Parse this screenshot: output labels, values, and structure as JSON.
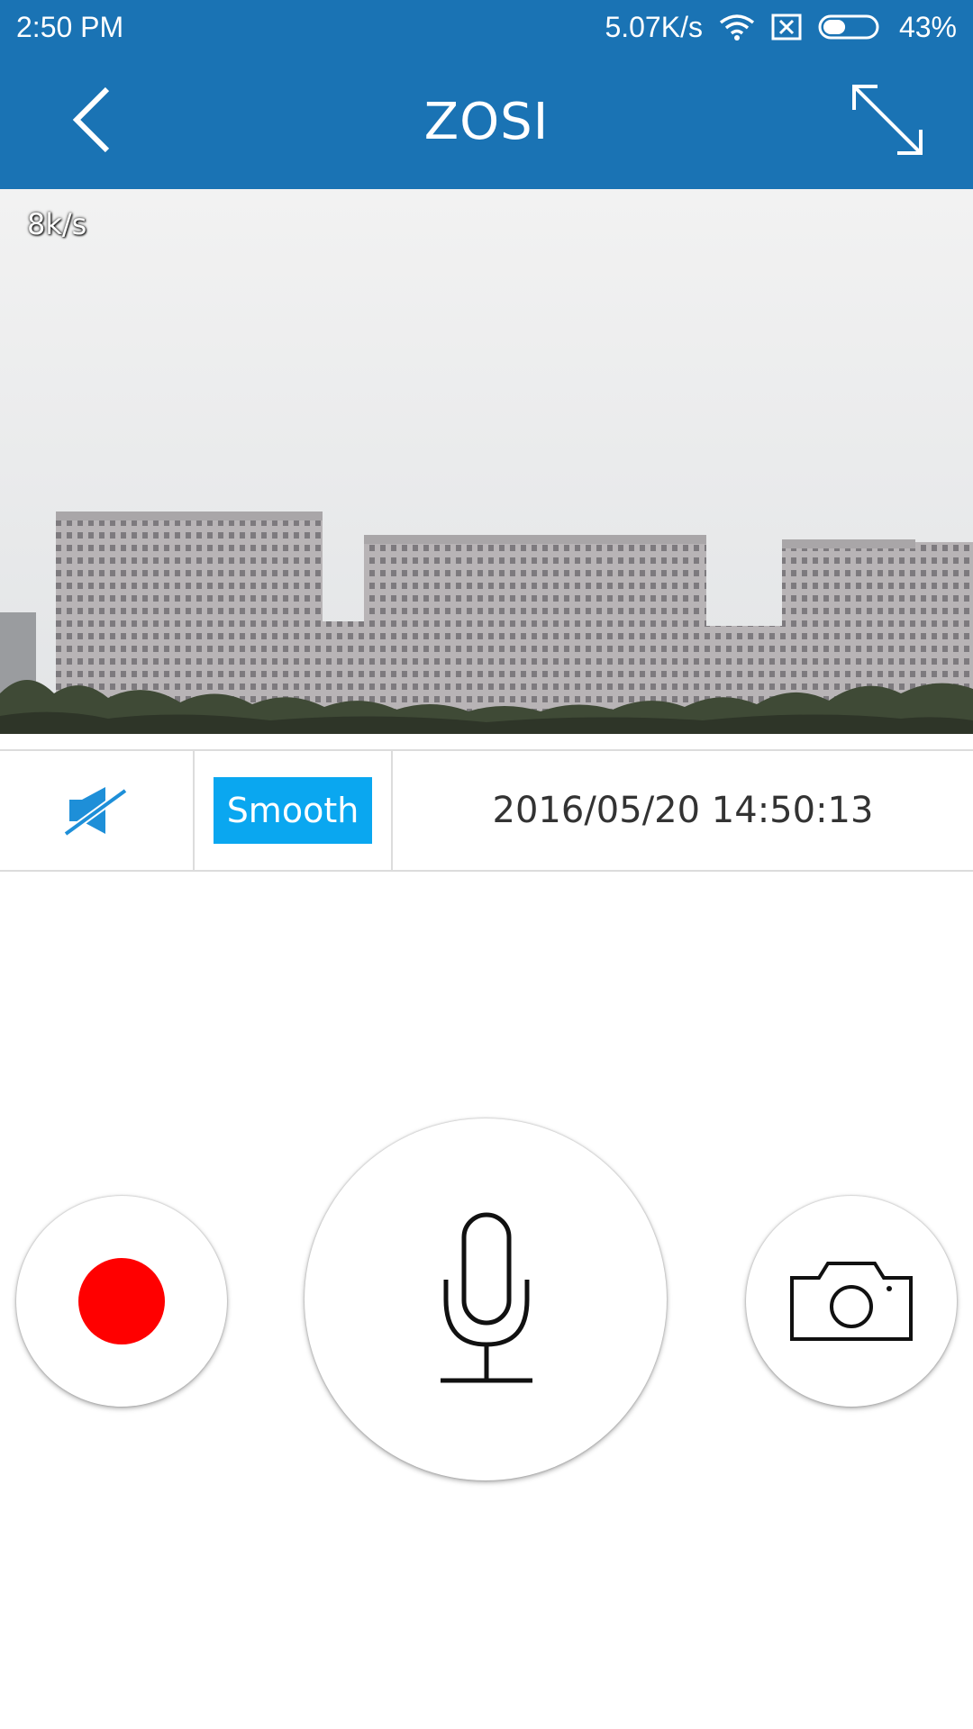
{
  "status_bar": {
    "time": "2:50 PM",
    "network_speed": "5.07K/s",
    "battery": "43%",
    "battery_level": 0.43
  },
  "header": {
    "title": "ZOSI",
    "back_icon": "chevron-left-icon",
    "fullscreen_icon": "expand-icon"
  },
  "video": {
    "bitrate": "8k/s"
  },
  "controls": {
    "mute_icon": "speaker-muted-icon",
    "quality_label": "Smooth",
    "timestamp": "2016/05/20 14:50:13"
  },
  "actions": {
    "record_icon": "record-icon",
    "talk_icon": "microphone-icon",
    "snapshot_icon": "camera-icon"
  },
  "colors": {
    "app_bar": "#1a73b4",
    "accent": "#0aa7f0",
    "record": "#ff0000"
  }
}
